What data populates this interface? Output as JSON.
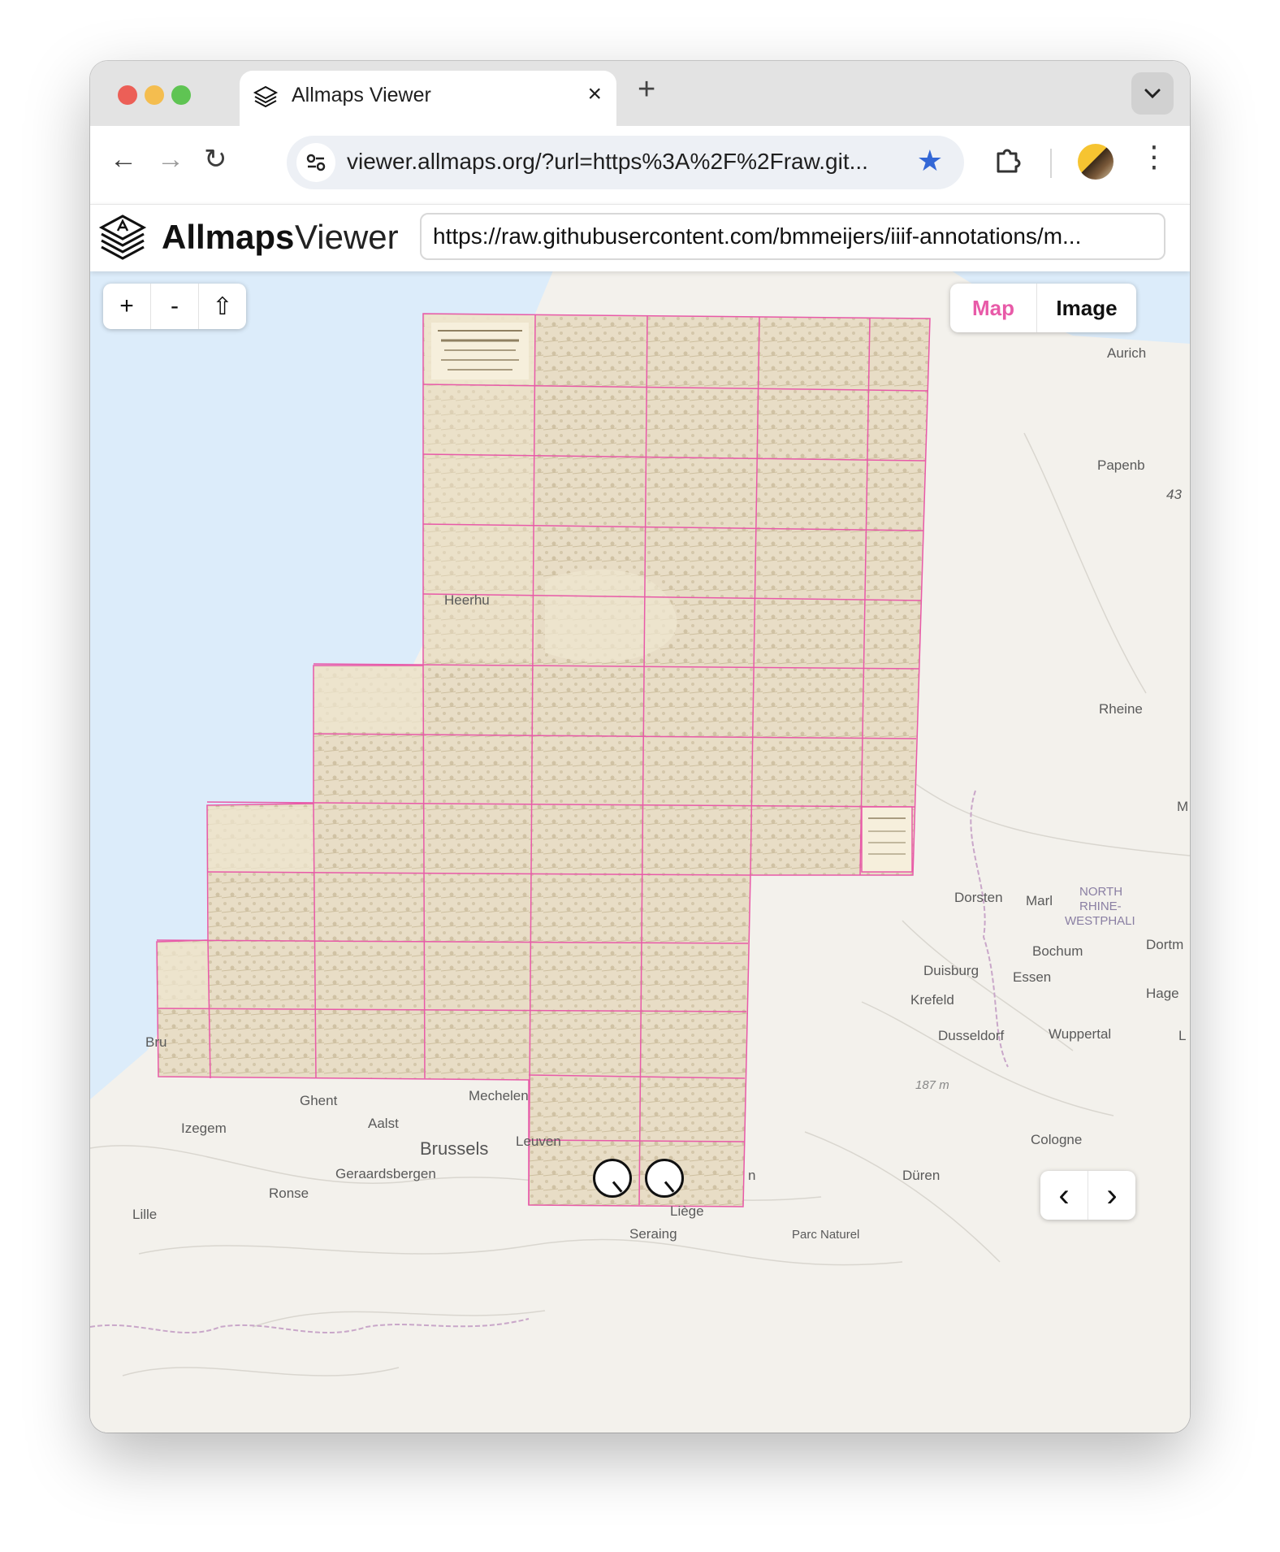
{
  "browser": {
    "tab_title": "Allmaps Viewer",
    "tab_icon": "allmaps-logo-icon",
    "address": "viewer.allmaps.org/?url=https%3A%2F%2Fraw.git...",
    "new_tab_label": "+",
    "close_tab_label": "×",
    "back_label": "←",
    "forward_label": "→",
    "reload_label": "↻",
    "bookmark_label": "★",
    "menu_label": "⋮"
  },
  "app": {
    "brand_bold": "Allmaps",
    "brand_light": "Viewer",
    "url_value": "https://raw.githubusercontent.com/bmmeijers/iiif-annotations/m...",
    "zoom_in_label": "+",
    "zoom_out_label": "-",
    "home_label": "⇧",
    "view_toggle": {
      "map_label": "Map",
      "image_label": "Image",
      "active": "Map"
    },
    "prev_label": "‹",
    "next_label": "›"
  },
  "map_labels": {
    "aurich": "Aurich",
    "papenburg": "Papenb",
    "num43": "43",
    "heerhugowaard": "Heerhu",
    "rheine": "Rheine",
    "m": "M",
    "dorsten": "Dorsten",
    "marl": "Marl",
    "nrw1": "NORTH",
    "nrw2": "RHINE-",
    "nrw3": "WESTPHALI",
    "bochum": "Bochum",
    "dortmund": "Dortm",
    "duisburg": "Duisburg",
    "essen": "Essen",
    "krefeld": "Krefeld",
    "hagen": "Hage",
    "dusseldorf": "Dusseldorf",
    "wuppertal": "Wuppertal",
    "l": "L",
    "elevation": "187 m",
    "cologne": "Cologne",
    "bruges": "Bru",
    "ghent": "Ghent",
    "mechelen": "Mechelen",
    "izegem": "Izegem",
    "aalst": "Aalst",
    "brussels": "Brussels",
    "leuven": "Leuven",
    "geraardsbergen": "Geraardsbergen",
    "ronse": "Ronse",
    "lille": "Lille",
    "n": "n",
    "duren": "Düren",
    "liege": "Liège",
    "seraing": "Seraing",
    "parc": "Parc Naturel"
  },
  "colors": {
    "accent": "#e85aa8",
    "sea": "#dcecfa",
    "land": "#f3f1ec",
    "sheet": "#efe6cf",
    "grid": "#e85aa8"
  }
}
